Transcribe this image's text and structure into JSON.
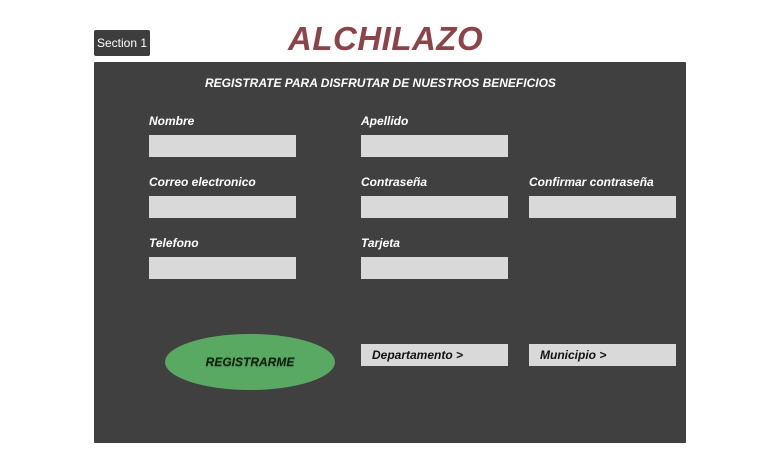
{
  "section_tag": "Section 1",
  "brand": "ALCHILAZO",
  "form": {
    "heading": "REGISTRATE PARA DISFRUTAR DE NUESTROS BENEFICIOS",
    "fields": {
      "nombre": {
        "label": "Nombre",
        "value": ""
      },
      "apellido": {
        "label": "Apellido",
        "value": ""
      },
      "correo": {
        "label": "Correo electronico",
        "value": ""
      },
      "contrasena": {
        "label": "Contraseña",
        "value": ""
      },
      "confirmar": {
        "label": "Confirmar contraseña",
        "value": ""
      },
      "telefono": {
        "label": "Telefono",
        "value": ""
      },
      "tarjeta": {
        "label": "Tarjeta",
        "value": ""
      }
    },
    "register_label": "REGISTRARME",
    "departamento_label": "Departamento >",
    "municipio_label": "Municipio >"
  },
  "colors": {
    "brand": "#8c4448",
    "panel": "#404040",
    "input": "#d9d9d9",
    "button": "#5aa963"
  }
}
